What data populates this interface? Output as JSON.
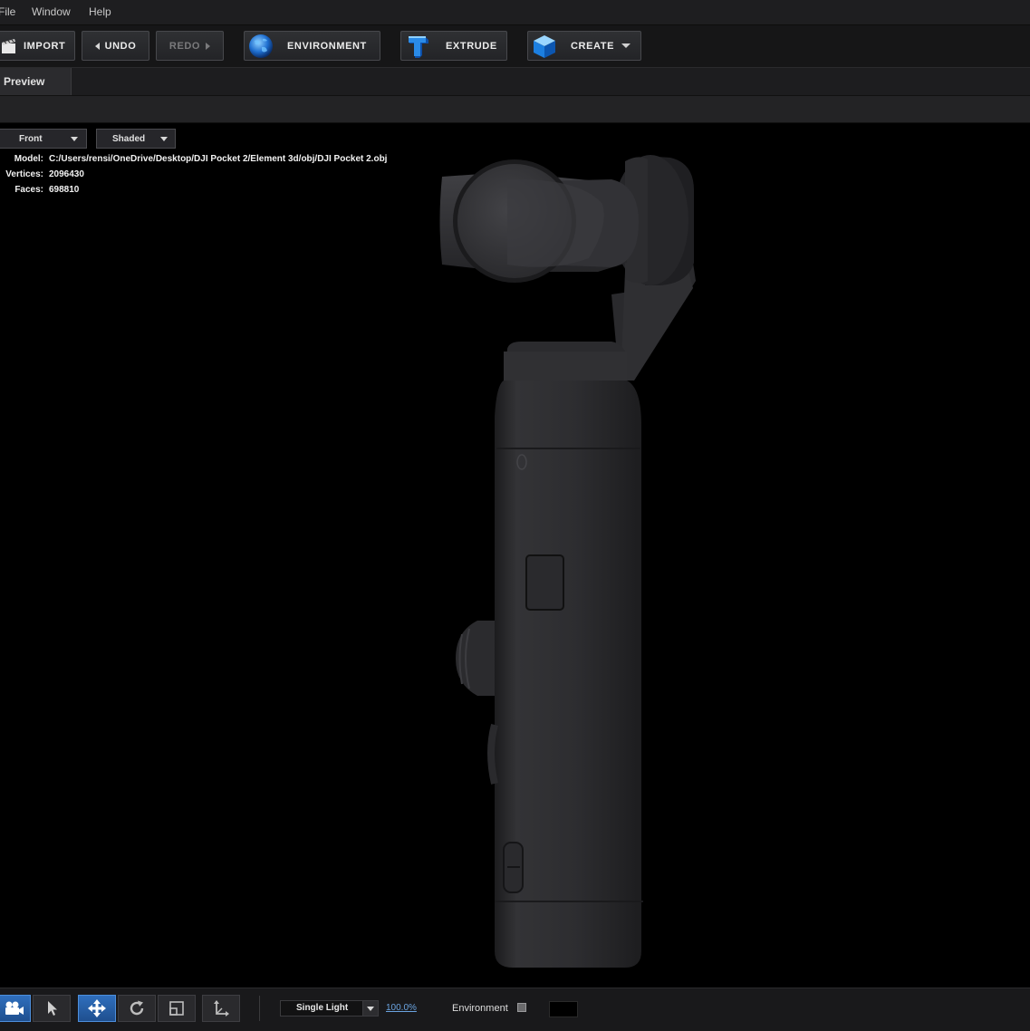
{
  "menu": {
    "file": "File",
    "window": "Window",
    "help": "Help"
  },
  "toolbar": {
    "import": "IMPORT",
    "undo": "UNDO",
    "redo": "REDO",
    "environment": "ENVIRONMENT",
    "extrude": "EXTRUDE",
    "create": "CREATE"
  },
  "panel": {
    "tab": "Preview"
  },
  "viewport": {
    "view_mode": "Front",
    "shading_mode": "Shaded",
    "info": {
      "model_label": "Model:",
      "model_value": "C:/Users/rensi/OneDrive/Desktop/DJI Pocket 2/Element 3d/obj/DJI Pocket 2.obj",
      "vertices_label": "Vertices:",
      "vertices_value": "2096430",
      "faces_label": "Faces:",
      "faces_value": "698810"
    }
  },
  "bottombar": {
    "lighting": "Single Light",
    "zoom": "100.0%",
    "environment_label": "Environment",
    "environment_checked": false,
    "background_color": "#000000"
  },
  "icons": {
    "import": "clapperboard-icon",
    "environment": "globe-icon",
    "extrude": "extrude-t-icon",
    "create": "cube-icon",
    "camera": "camera-icon",
    "select": "cursor-arrow-icon",
    "move": "move-arrows-icon",
    "rotate": "rotate-icon",
    "scale": "scale-icon",
    "axis": "axis-icon"
  },
  "colors": {
    "accent": "#2f6fbd",
    "link": "#6aa3e0",
    "panel": "#1d1d1f",
    "viewport": "#000000"
  }
}
